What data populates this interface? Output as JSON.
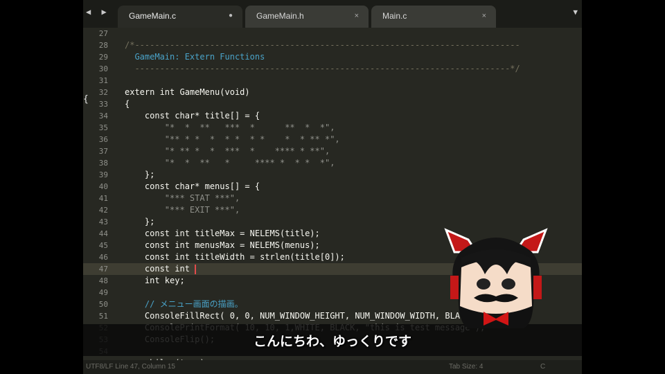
{
  "tabs": [
    {
      "label": "GameMain.c",
      "close": "●",
      "active": true
    },
    {
      "label": "GameMain.h",
      "close": "×",
      "active": false
    },
    {
      "label": "Main.c",
      "close": "×",
      "active": false
    }
  ],
  "nav": {
    "arrows": "◀ ▶",
    "menu": "▼"
  },
  "editor": {
    "gutter_marker": "{",
    "lines": [
      {
        "n": "27",
        "code": ""
      },
      {
        "n": "28",
        "code": "/*-----------------------------------------------------------------------------"
      },
      {
        "n": "29",
        "code": "  GameMain: Extern Functions"
      },
      {
        "n": "30",
        "code": "  ---------------------------------------------------------------------------*/"
      },
      {
        "n": "31",
        "code": ""
      },
      {
        "n": "32",
        "code": "extern int GameMenu(void)"
      },
      {
        "n": "33",
        "code": "{"
      },
      {
        "n": "34",
        "code": "    const char* title[] = {"
      },
      {
        "n": "35",
        "code": "        \"*  *  **   ***  *      **  *  *\","
      },
      {
        "n": "36",
        "code": "        \"** * *  *  * *  * *    *  * ** *\","
      },
      {
        "n": "37",
        "code": "        \"* ** *  *  ***  *    **** * **\","
      },
      {
        "n": "38",
        "code": "        \"*  *  **   *     **** *  * *  *\","
      },
      {
        "n": "39",
        "code": "    };"
      },
      {
        "n": "40",
        "code": "    const char* menus[] = {"
      },
      {
        "n": "41",
        "code": "        \"*** STAT ***\","
      },
      {
        "n": "42",
        "code": "        \"*** EXIT ***\","
      },
      {
        "n": "43",
        "code": "    };"
      },
      {
        "n": "44",
        "code": "    const int titleMax = NELEMS(title);"
      },
      {
        "n": "45",
        "code": "    const int menusMax = NELEMS(menus);"
      },
      {
        "n": "46",
        "code": "    const int titleWidth = strlen(title[0]);"
      },
      {
        "n": "47",
        "code": "    const int ",
        "current": true
      },
      {
        "n": "48",
        "code": "    int key;"
      },
      {
        "n": "49",
        "code": ""
      },
      {
        "n": "50",
        "code": "    // メニュー画面の描画。"
      },
      {
        "n": "51",
        "code": "    ConsoleFillRect( 0, 0, NUM_WINDOW_HEIGHT, NUM_WINDOW_WIDTH, BLACK, \" \");"
      },
      {
        "n": "52",
        "code": "    ConsolePrintFormat( 10, 10, 1,WHITE, BLACK, \"this is test message\");"
      },
      {
        "n": "53",
        "code": "    ConsoleFlip();"
      },
      {
        "n": "54",
        "code": ""
      },
      {
        "n": "55",
        "code": "    while (true)"
      }
    ]
  },
  "statusbar": {
    "left": "UTF8/LF  Line 47, Column 15",
    "mid": "Tab Size: 4",
    "right": "C"
  },
  "subtitle": "こんにちわ、ゆっくりです",
  "colors": {
    "background": "#272822",
    "current_line": "#3e3d32",
    "cursor": "#e34b4b",
    "comment_blue": "#4aa3c9"
  }
}
